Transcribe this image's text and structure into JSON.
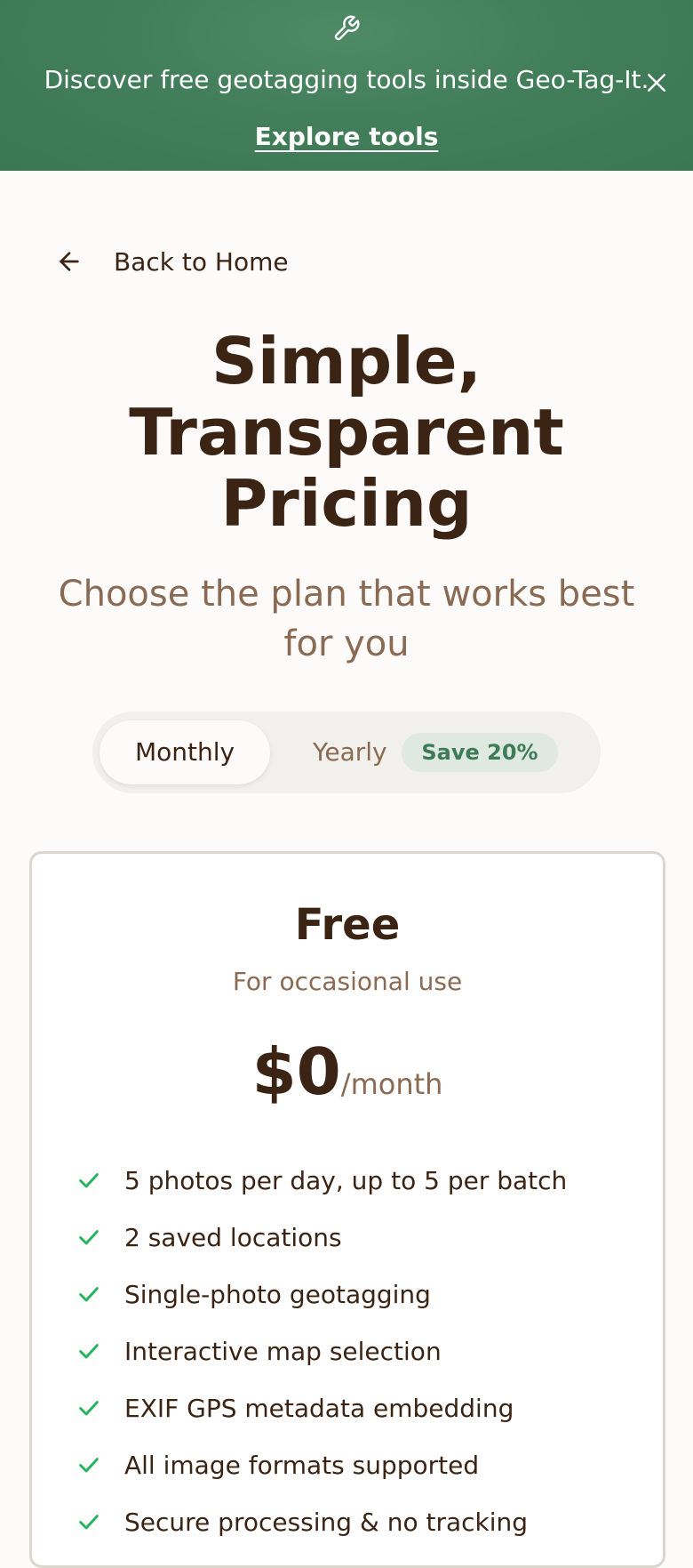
{
  "banner": {
    "icon": "wrench-icon",
    "message": "Discover free geotagging tools inside Geo-Tag-It.",
    "cta": "Explore tools",
    "close_icon": "close-icon"
  },
  "nav": {
    "back_label": "Back to Home",
    "back_icon": "arrow-left-icon"
  },
  "hero": {
    "title_lines": [
      "Simple,",
      "Transparent",
      "Pricing"
    ],
    "subtitle": "Choose the plan that works best for you"
  },
  "billing_toggle": {
    "monthly": "Monthly",
    "yearly": "Yearly",
    "save_badge": "Save 20%",
    "selected": "Monthly"
  },
  "plans": [
    {
      "name": "Free",
      "description": "For occasional use",
      "price": "$0",
      "period": "/month",
      "features": [
        "5 photos per day, up to 5 per batch",
        "2 saved locations",
        "Single-photo geotagging",
        "Interactive map selection",
        "EXIF GPS metadata embedding",
        "All image formats supported",
        "Secure processing & no tracking"
      ]
    }
  ],
  "colors": {
    "banner_bg": "#427e5a",
    "accent_green": "#3e7b56",
    "check_green": "#22b55a",
    "text_dark": "#3b2414",
    "text_muted": "#8a6a52",
    "page_bg": "#fcfbf9"
  }
}
